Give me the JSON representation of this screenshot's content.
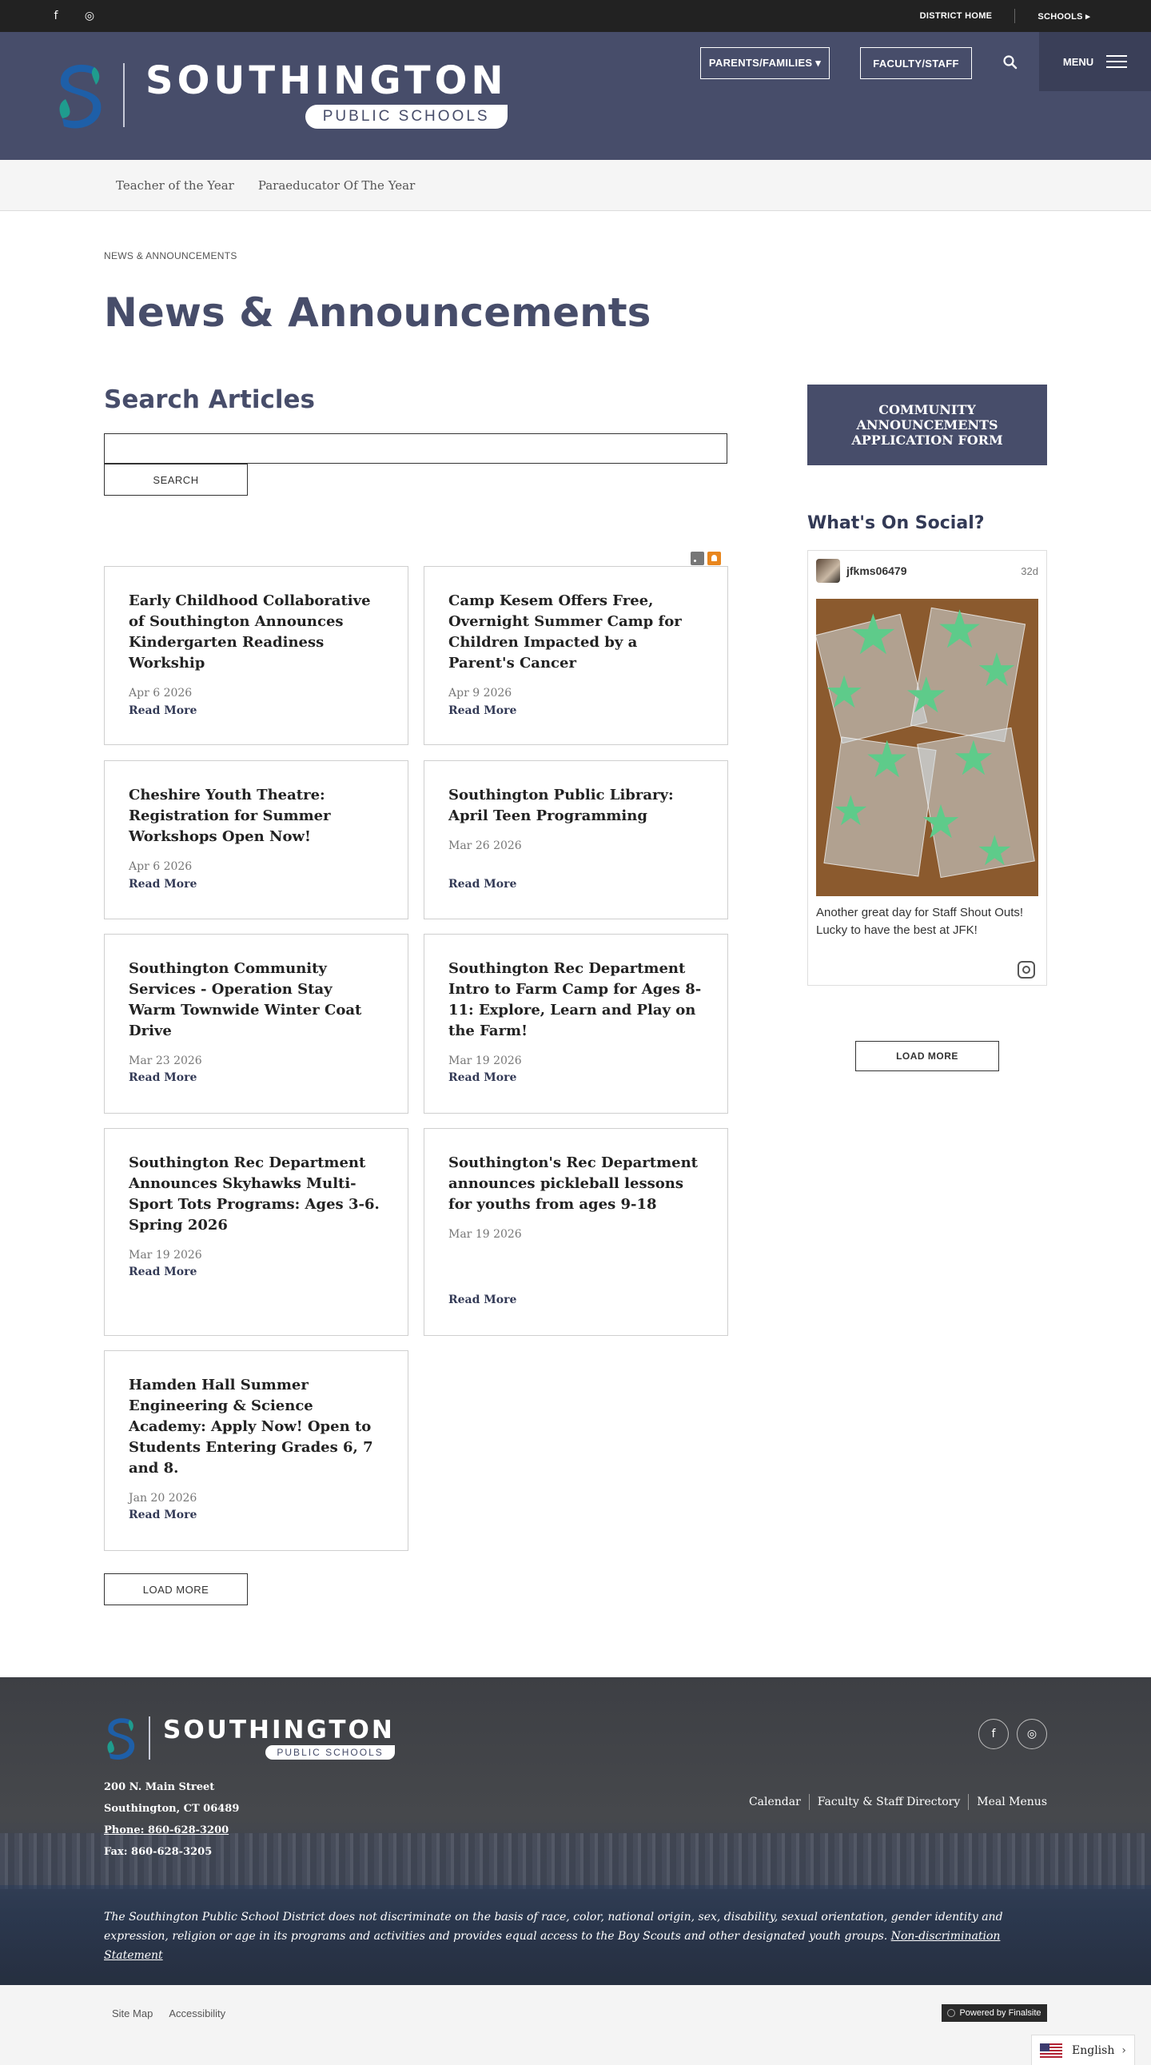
{
  "utility": {
    "social": [
      "f",
      "◎"
    ],
    "district_home": "DISTRICT HOME",
    "schools": "SCHOOLS ▸"
  },
  "header": {
    "logo_name": "SOUTHINGTON",
    "logo_sub": "PUBLIC SCHOOLS",
    "parents": "PARENTS/FAMILIES ▾",
    "faculty": "FACULTY/STAFF",
    "menu": "MENU"
  },
  "subnav": [
    "Teacher of the Year",
    "Paraeducator Of The Year"
  ],
  "breadcrumb": "NEWS & ANNOUNCEMENTS",
  "page_title": "News & Announcements",
  "search": {
    "heading": "Search Articles",
    "value": "",
    "button": "SEARCH"
  },
  "articles": [
    {
      "title": "Early Childhood Collaborative of Southington Announces Kindergarten Readiness Workship",
      "date": "Apr 6 2026",
      "more": "Read More"
    },
    {
      "title": "Camp Kesem Offers Free, Overnight Summer Camp for Children Impacted by a Parent's Cancer",
      "date": "Apr 9 2026",
      "more": "Read More"
    },
    {
      "title": "Cheshire Youth Theatre: Registration for Summer Workshops Open Now!",
      "date": "Apr 6 2026",
      "more": "Read More"
    },
    {
      "title": "Southington Public Library: April Teen Programming",
      "date": "Mar 26 2026",
      "more": "Read More"
    },
    {
      "title": "Southington Community Services - Operation Stay Warm Townwide Winter Coat Drive",
      "date": "Mar 23 2026",
      "more": "Read More"
    },
    {
      "title": "Southington Rec Department Intro to Farm Camp for Ages 8-11: Explore, Learn and Play on the Farm!",
      "date": "Mar 19 2026",
      "more": "Read More"
    },
    {
      "title": "Southington Rec Department Announces Skyhawks Multi-Sport Tots Programs: Ages 3-6.  Spring 2026",
      "date": "Mar 19 2026",
      "more": "Read More"
    },
    {
      "title": "Southington's Rec Department announces pickleball lessons for youths from ages 9-18",
      "date": "Mar 19 2026",
      "more": "Read More"
    },
    {
      "title": "Hamden Hall Summer Engineering & Science Academy: Apply Now! Open to Students Entering Grades 6, 7 and 8.",
      "date": "Jan 20 2026",
      "more": "Read More"
    }
  ],
  "load_more_main": "LOAD MORE",
  "sidebar": {
    "community_button": "COMMUNITY ANNOUNCEMENTS APPLICATION FORM",
    "social_heading": "What's On Social?",
    "post": {
      "user": "jfkms06479",
      "age": "32d",
      "caption": "Another great day for Staff Shout Outs! Lucky to have the best at JFK!"
    },
    "load_more": "LOAD MORE"
  },
  "footer": {
    "logo_name": "SOUTHINGTON",
    "logo_sub": "PUBLIC SCHOOLS",
    "social": [
      "f",
      "◎"
    ],
    "address1": "200 N. Main Street",
    "address2": "Southington, CT  06489",
    "phone": "Phone: 860-628-3200",
    "fax": "Fax: 860-628-3205",
    "links": [
      "Calendar",
      "Faculty & Staff Directory",
      "Meal Menus"
    ],
    "disclaimer": "The Southington Public School District does not discriminate on the basis of race, color, national origin, sex, disability, sexual orientation, gender identity and expression, religion or age in its programs and activities and provides equal access to the Boy Scouts and other designated youth groups.",
    "disclaimer_link": "Non-discrimination Statement"
  },
  "bottom": {
    "links": [
      "Site Map",
      "Accessibility"
    ],
    "powered": "Powered by Finalsite",
    "language": "English",
    "language_arrow": "›"
  },
  "colors": {
    "brand_navy": "#474d6a",
    "logo_teal": "#1f9c8e",
    "logo_blue": "#1e5fa8"
  }
}
